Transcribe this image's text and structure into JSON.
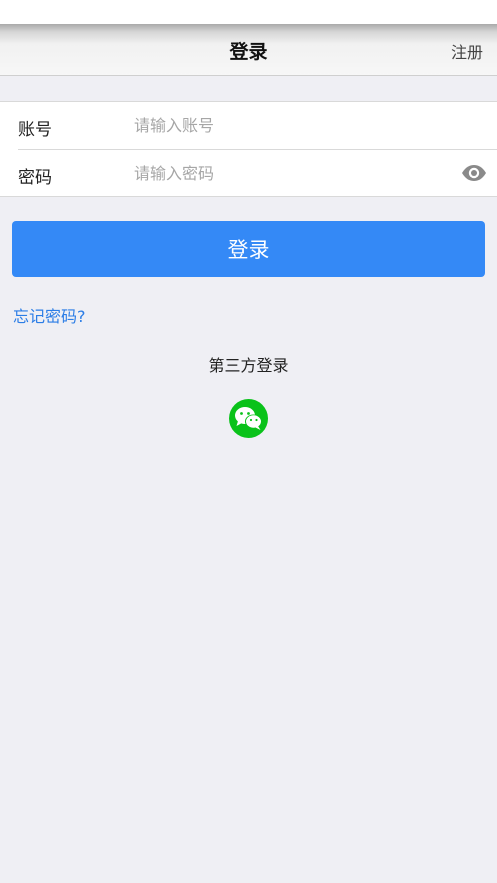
{
  "nav": {
    "title": "登录",
    "right_action": "注册"
  },
  "form": {
    "account": {
      "label": "账号",
      "placeholder": "请输入账号",
      "value": ""
    },
    "password": {
      "label": "密码",
      "placeholder": "请输入密码",
      "value": ""
    }
  },
  "login_button": {
    "label": "登录",
    "color": "#3489f6"
  },
  "forgot_password": {
    "label": "忘记密码?"
  },
  "third_party": {
    "label": "第三方登录",
    "icons": [
      "wechat-icon"
    ],
    "wechat_color": "#0ac21a"
  },
  "icons": {
    "password_toggle": "eye-icon"
  }
}
